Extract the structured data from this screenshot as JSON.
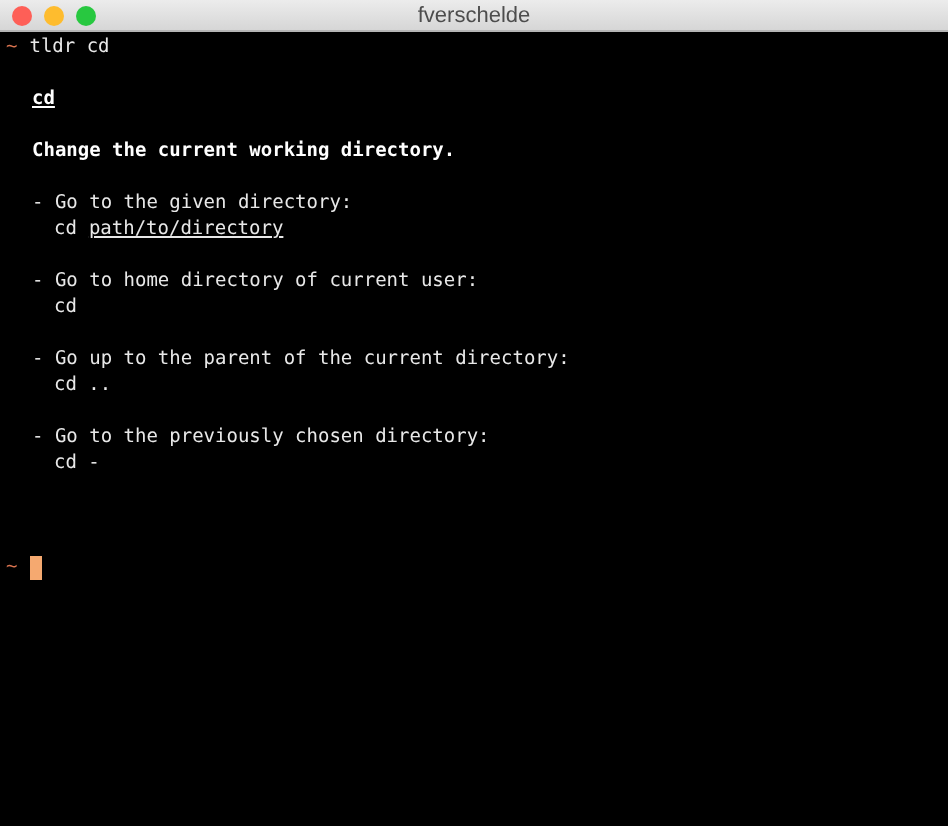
{
  "window": {
    "title": "fverschelde"
  },
  "command_line": {
    "prompt": "~",
    "command": "tldr cd"
  },
  "page": {
    "name": "cd",
    "description": "Change the current working directory.",
    "examples": [
      {
        "description": "- Go to the given directory:",
        "command": "cd",
        "argument": "path/to/directory"
      },
      {
        "description": "- Go to home directory of current user:",
        "command": "cd"
      },
      {
        "description": "- Go up to the parent of the current directory:",
        "command": "cd .."
      },
      {
        "description": "- Go to the previously chosen directory:",
        "command": "cd -"
      }
    ]
  },
  "next_prompt": {
    "prompt": "~"
  }
}
